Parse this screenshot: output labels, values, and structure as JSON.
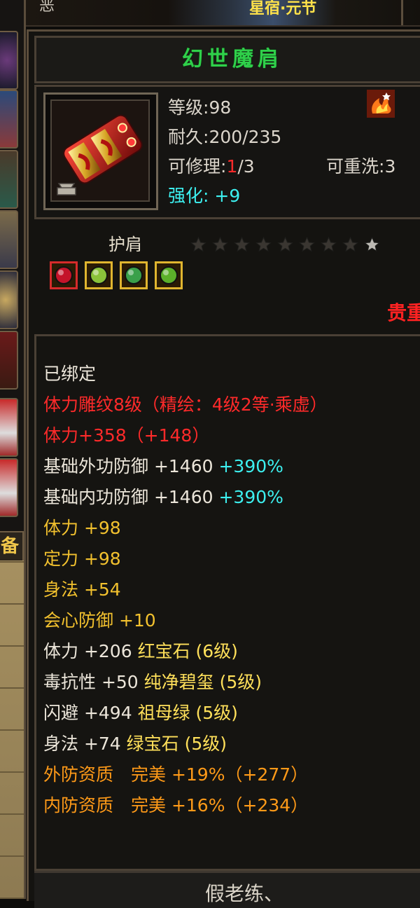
{
  "top": {
    "left_text": "恶",
    "right_text": "星宿·元节"
  },
  "sidebar": {
    "tab_label": "备"
  },
  "item": {
    "name": "幻世魔肩",
    "level_label": "等级:",
    "level": "98",
    "durability_label": "耐久:",
    "durability": "200/235",
    "repair_label": "可修理:",
    "repair_used": "1",
    "repair_total": "/3",
    "rewash_label": "可重洗:",
    "rewash": "3",
    "enhance_label": "强化:",
    "enhance": "+9",
    "type": "护肩",
    "stars_filled": 8,
    "stars_total": 9,
    "corner_text": "贵重",
    "icon_flame": "flame-icon"
  },
  "gems": [
    {
      "name": "red-gem-icon",
      "color": "#c4142a",
      "border": "#d62b2b"
    },
    {
      "name": "green-gem-icon",
      "color": "#8ac23a",
      "border": "#e0b52f"
    },
    {
      "name": "jade-gem-icon",
      "color": "#3aa04a",
      "border": "#e0b52f"
    },
    {
      "name": "emerald-gem-icon",
      "color": "#5cb02a",
      "border": "#e0b52f"
    }
  ],
  "attributes": {
    "bound": "已绑定",
    "engrave": "体力雕纹8级（精绘：4级2等·乘虚）",
    "stamina_main": "体力+358（+148）",
    "ext_def_label": "基础外功防御 +1460",
    "ext_def_pct": "+390%",
    "int_def_label": "基础内功防御 +1460",
    "int_def_pct": "+390%",
    "g1": "体力 +98",
    "g2": "定力 +98",
    "g3": "身法 +54",
    "g4": "会心防御 +10",
    "gem1_stat": "体力 +206",
    "gem1_name": "红宝石 (6级)",
    "gem2_stat": "毒抗性 +50",
    "gem2_name": "纯净碧玺 (5级)",
    "gem3_stat": "闪避 +494",
    "gem3_name": "祖母绿 (5级)",
    "gem4_stat": "身法 +74",
    "gem4_name": "绿宝石 (5级)",
    "q1": "外防资质　完美 +19%（+277）",
    "q2": "内防资质　完美 +16%（+234）"
  },
  "bottom": {
    "text": "假老练、"
  }
}
